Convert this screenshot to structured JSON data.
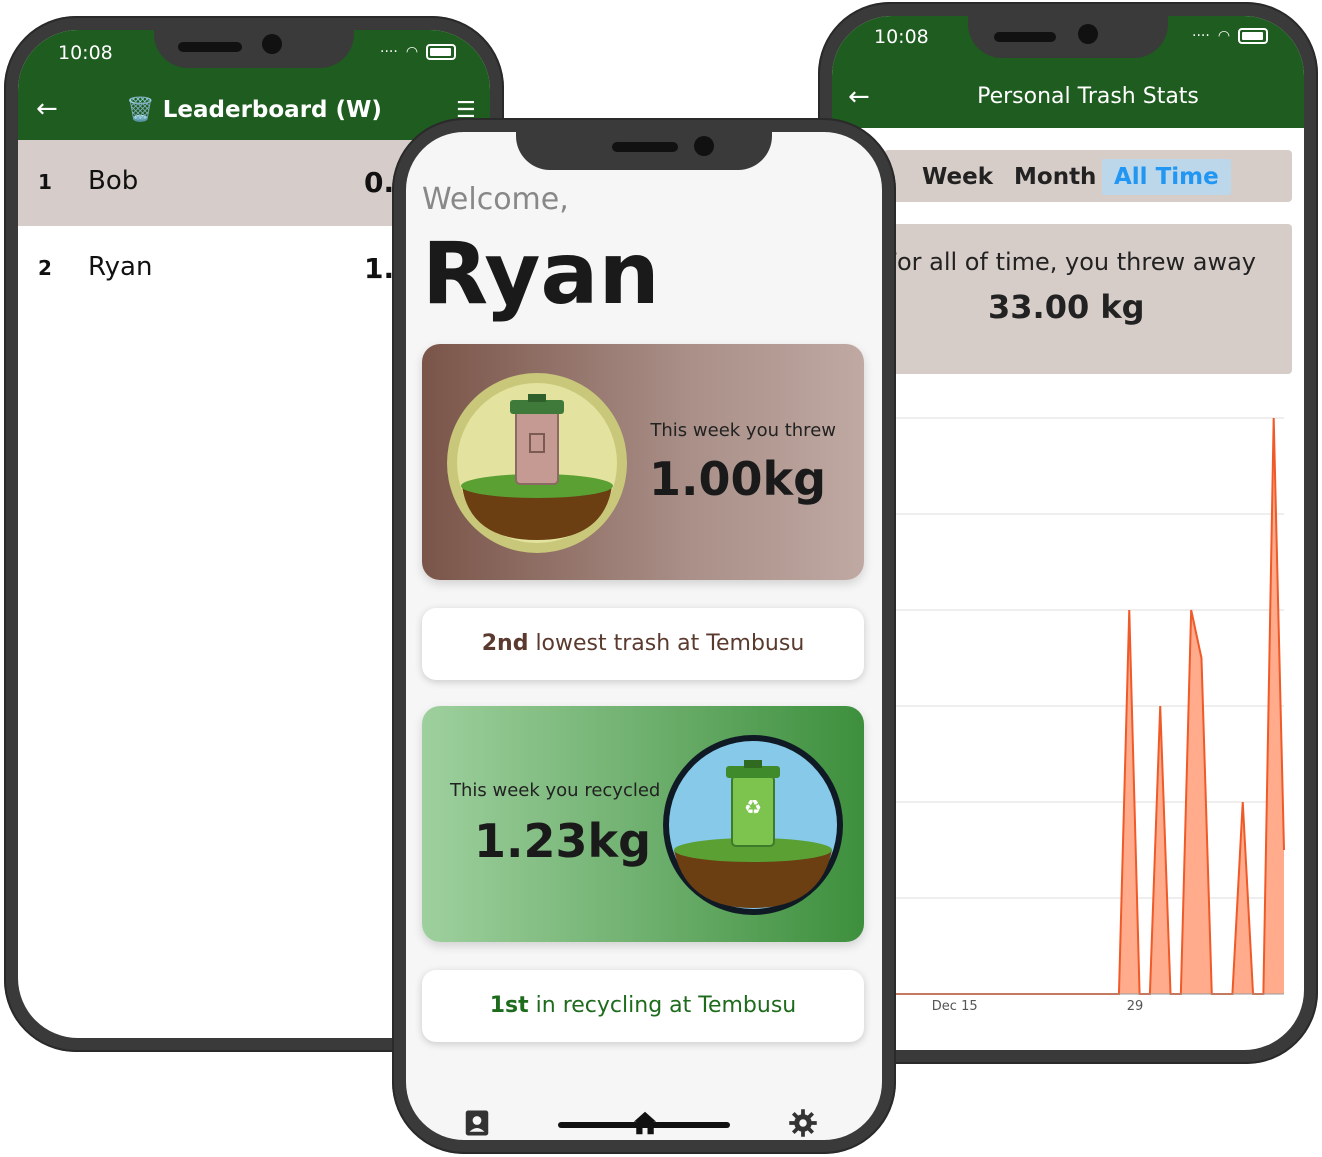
{
  "leaderboard_screen": {
    "status_time": "10:08",
    "title": "Leaderboard (W)",
    "title_emoji": "🗑️",
    "back_icon": "arrow-left-icon",
    "filter_icon": "filter-icon",
    "rows": [
      {
        "rank": "1",
        "name": "Bob",
        "score": "0."
      },
      {
        "rank": "2",
        "name": "Ryan",
        "score": "1."
      }
    ]
  },
  "stats_screen": {
    "status_time": "10:08",
    "title": "Personal Trash Stats",
    "back_icon": "arrow-left-icon",
    "tabs": [
      "Week",
      "Month",
      "All Time"
    ],
    "active_tab": "All Time",
    "total_label": "For all of time, you threw away",
    "total_value": "33.00 kg",
    "chart_data": {
      "type": "area",
      "x_ticks": [
        "Dec 15",
        "29"
      ],
      "series_color": "#f05a28",
      "fill_color": "#ffab8c",
      "grid": true,
      "series": [
        {
          "values": [
            0,
            0,
            0,
            0,
            0,
            0,
            0,
            0,
            0,
            0,
            0,
            0,
            0,
            0,
            0,
            0,
            0,
            0,
            0,
            0,
            0,
            0,
            0,
            4,
            0,
            0,
            3,
            0,
            0,
            4,
            3.5,
            0,
            0,
            0,
            2,
            0,
            0,
            6,
            1.5
          ]
        }
      ]
    }
  },
  "home_screen": {
    "welcome": "Welcome,",
    "name": "Ryan",
    "trash_card": {
      "label": "This week you threw",
      "value": "1.00kg"
    },
    "trash_rank": {
      "strong": "2nd",
      "rest": " lowest trash at Tembusu"
    },
    "recycle_card": {
      "label": "This week you recycled",
      "value": "1.23kg"
    },
    "recycle_rank": {
      "strong": "1st",
      "rest": " in recycling at Tembusu"
    },
    "nav": [
      "profile-icon",
      "home-icon",
      "settings-icon"
    ],
    "colors": {
      "trash_rank_text": "#5a3a2e",
      "recycle_rank_text": "#1e6b1e",
      "app_green": "#1e5c1f"
    }
  }
}
